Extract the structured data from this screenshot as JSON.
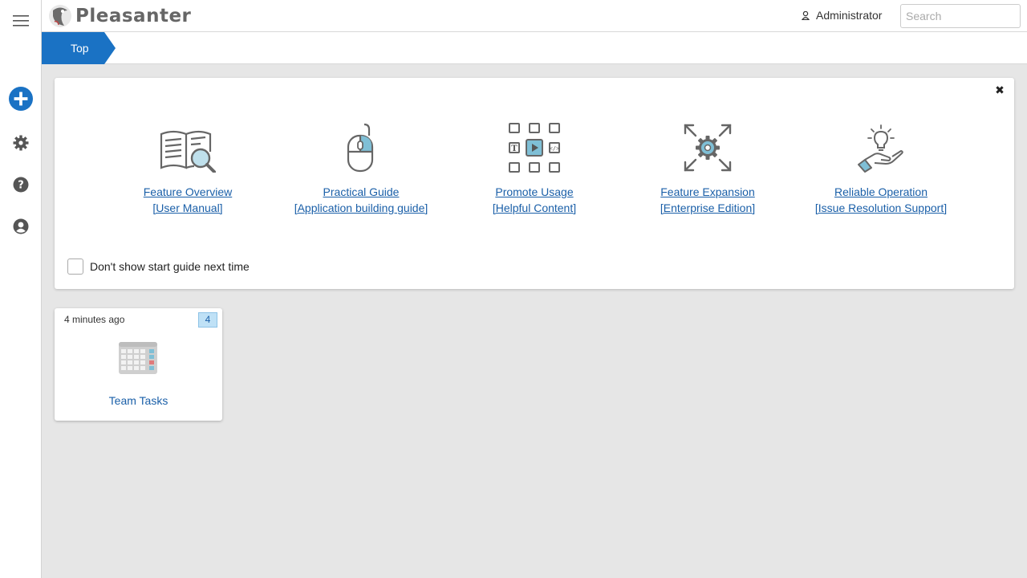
{
  "app": {
    "name": "Pleasanter"
  },
  "sidebar": {
    "items": [
      {
        "icon": "menu-icon"
      },
      {
        "icon": "plus-circle-icon"
      },
      {
        "icon": "gear-icon"
      },
      {
        "icon": "help-icon"
      },
      {
        "icon": "user-icon"
      }
    ]
  },
  "header": {
    "user_name": "Administrator",
    "search_placeholder": "Search"
  },
  "breadcrumb": {
    "top": "Top"
  },
  "start_guide": {
    "items": [
      {
        "title": "Feature Overview",
        "subtitle": "[User Manual]",
        "icon": "book-search-icon"
      },
      {
        "title": "Practical Guide",
        "subtitle": "[Application building guide]",
        "icon": "mouse-icon"
      },
      {
        "title": "Promote Usage",
        "subtitle": "[Helpful Content]",
        "icon": "content-grid-icon"
      },
      {
        "title": "Feature Expansion",
        "subtitle": "[Enterprise Edition]",
        "icon": "expand-gear-icon"
      },
      {
        "title": "Reliable Operation",
        "subtitle": "[Issue Resolution Support]",
        "icon": "hand-bulb-icon"
      }
    ],
    "dont_show_label": "Don't show start guide next time",
    "accent": "#7fbfd6"
  },
  "sites": [
    {
      "time": "4 minutes ago",
      "count": "4",
      "title": "Team Tasks",
      "icon": "table-icon"
    }
  ],
  "colors": {
    "brand": "#1a72c4",
    "link": "#1a5fa8"
  }
}
